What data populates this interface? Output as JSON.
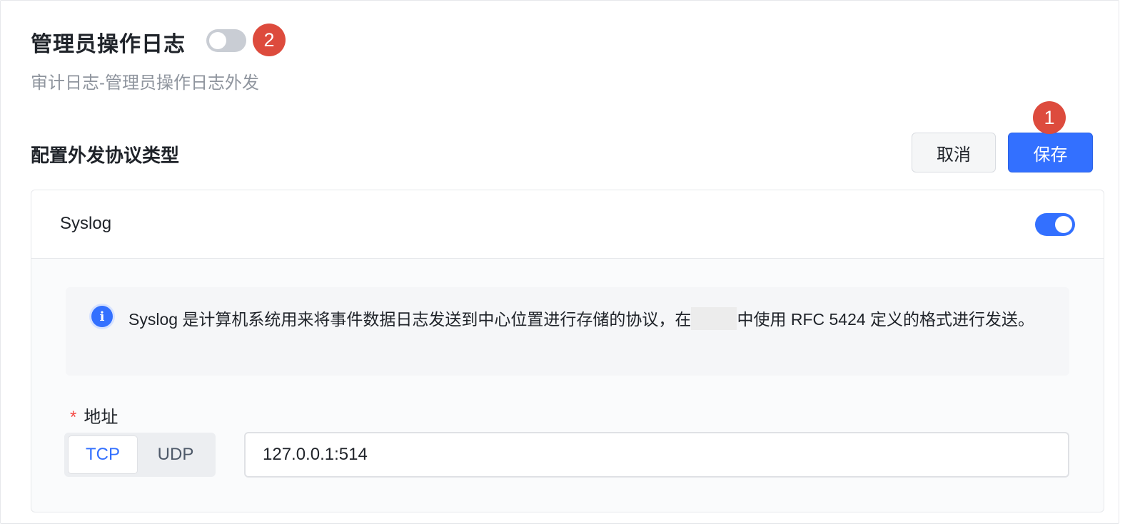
{
  "header": {
    "title": "管理员操作日志",
    "subtitle": "审计日志-管理员操作日志外发",
    "master_toggle_on": false,
    "badge_toggle": "2",
    "badge_save": "1"
  },
  "section": {
    "title": "配置外发协议类型",
    "cancel_label": "取消",
    "save_label": "保存"
  },
  "protocol_card": {
    "name": "Syslog",
    "enabled": true,
    "info_icon": "info-icon",
    "info_text_before": "Syslog 是计算机系统用来将事件数据日志发送到中心位置进行存储的协议，在",
    "info_text_after": "中使用 RFC 5424 定义的格式进行发送。",
    "address": {
      "label": "地址",
      "required_mark": "*",
      "transport_options": [
        "TCP",
        "UDP"
      ],
      "selected_transport": "TCP",
      "value": "127.0.0.1:514"
    }
  },
  "colors": {
    "primary": "#3370ff",
    "badge": "#dd4b3d",
    "toggle_off": "#c9cdd4"
  }
}
